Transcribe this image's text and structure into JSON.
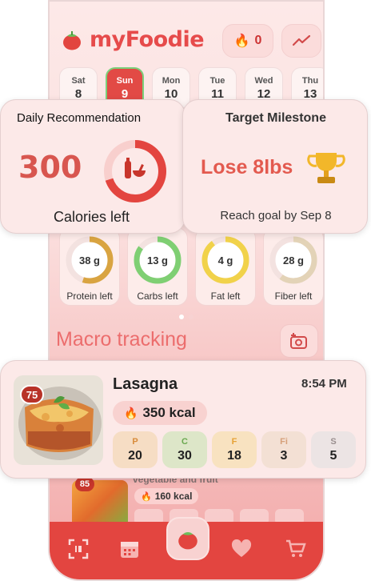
{
  "app": {
    "title": "myFoodie",
    "streak_count": "0"
  },
  "days": [
    {
      "name": "Sat",
      "date": "8",
      "active": false
    },
    {
      "name": "Sun",
      "date": "9",
      "active": true
    },
    {
      "name": "Mon",
      "date": "10",
      "active": false
    },
    {
      "name": "Tue",
      "date": "11",
      "active": false
    },
    {
      "name": "Wed",
      "date": "12",
      "active": false
    },
    {
      "name": "Thu",
      "date": "13",
      "active": false
    }
  ],
  "recommendation": {
    "title": "Daily Recommendation",
    "value": "300",
    "label": "Calories left",
    "progress": 0.7
  },
  "milestone": {
    "title": "Target Milestone",
    "goal": "Lose 8lbs",
    "reach": "Reach goal by Sep 8"
  },
  "macros": [
    {
      "value": "38 g",
      "label": "Protein left",
      "color": "#d9a441",
      "progress": 0.55
    },
    {
      "value": "13 g",
      "label": "Carbs left",
      "color": "#7fcf73",
      "progress": 0.85
    },
    {
      "value": "4 g",
      "label": "Fat left",
      "color": "#f1d24a",
      "progress": 0.9
    },
    {
      "value": "28 g",
      "label": "Fiber left",
      "color": "#e3d3b7",
      "progress": 0.6
    }
  ],
  "section": {
    "title": "Macro tracking"
  },
  "meal": {
    "score": "75",
    "name": "Lasagna",
    "time": "8:54 PM",
    "kcal": "350 kcal",
    "chips": [
      {
        "label": "P",
        "value": "20",
        "bg": "#f6ddc4",
        "fg": "#d88b3a"
      },
      {
        "label": "C",
        "value": "30",
        "bg": "#dde6c8",
        "fg": "#6aa84f"
      },
      {
        "label": "F",
        "value": "18",
        "bg": "#f8e2c0",
        "fg": "#e6a236"
      },
      {
        "label": "Fi",
        "value": "3",
        "bg": "#f3e0d4",
        "fg": "#d6a07a"
      },
      {
        "label": "S",
        "value": "5",
        "bg": "#ece4e4",
        "fg": "#9a8f8f"
      }
    ]
  },
  "meal2": {
    "score": "85",
    "partial_title": "vegetable and fruit",
    "kcal": "160 kcal"
  },
  "colors": {
    "accent": "#e34540",
    "brand": "#e64b4b"
  }
}
